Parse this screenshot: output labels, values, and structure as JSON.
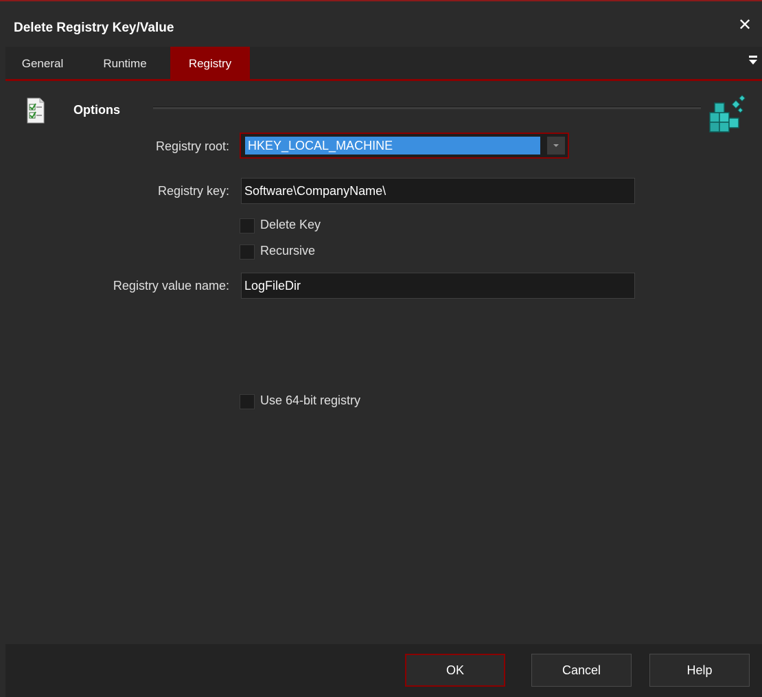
{
  "window": {
    "title": "Delete Registry Key/Value",
    "accent": "#8b0000"
  },
  "tabs": [
    {
      "label": "General",
      "active": false
    },
    {
      "label": "Runtime",
      "active": false
    },
    {
      "label": "Registry",
      "active": true
    }
  ],
  "options": {
    "section_title": "Options",
    "registry_root": {
      "label": "Registry root:",
      "value": "HKEY_LOCAL_MACHINE"
    },
    "registry_key": {
      "label": "Registry key:",
      "value": "Software\\CompanyName\\"
    },
    "delete_key": {
      "label": "Delete Key",
      "checked": false
    },
    "recursive": {
      "label": "Recursive",
      "checked": false
    },
    "registry_value_name": {
      "label": "Registry value name:",
      "value": "LogFileDir"
    },
    "use_64bit": {
      "label": "Use 64-bit registry",
      "checked": false
    }
  },
  "buttons": {
    "ok": "OK",
    "cancel": "Cancel",
    "help": "Help"
  },
  "icons": {
    "close": "close-icon",
    "tab_menu": "menu-icon",
    "options": "checklist-icon",
    "registry": "registry-cubes-icon"
  }
}
